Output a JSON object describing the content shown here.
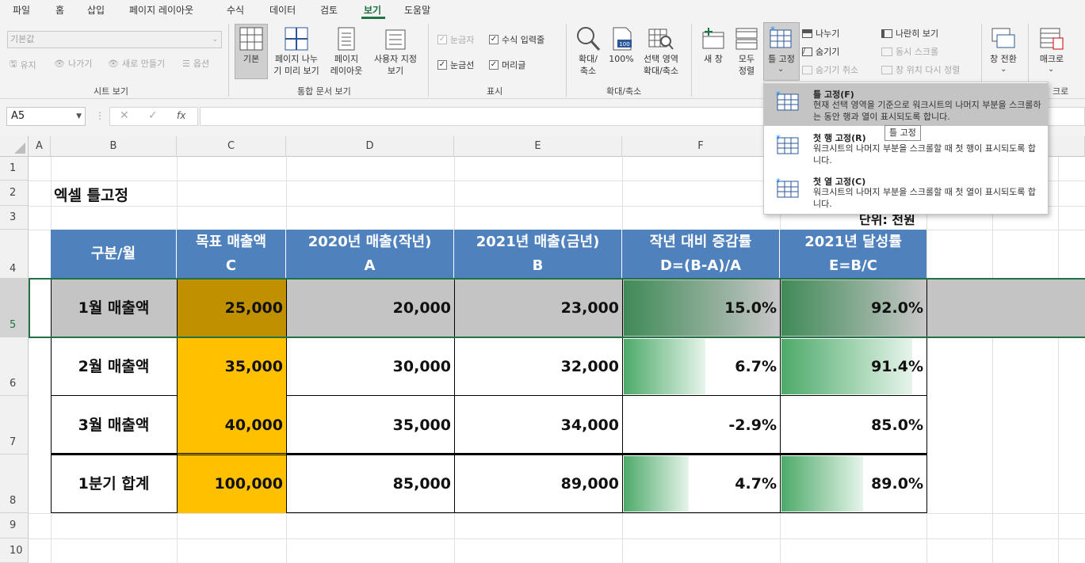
{
  "menu": [
    "파일",
    "홈",
    "삽입",
    "페이지 레이아웃",
    "수식",
    "데이터",
    "검토",
    "보기",
    "도움말"
  ],
  "ribbon": {
    "sheet_view": {
      "dropdown_value": "기본값",
      "keep": "유지",
      "exit": "나가기",
      "new": "새로 만들기",
      "options": "옵션",
      "label": "시트 보기"
    },
    "workbook_views": {
      "normal": "기본",
      "page_break_1": "페이지 나누",
      "page_break_2": "기 미리 보기",
      "page_layout_1": "페이지",
      "page_layout_2": "레이아웃",
      "custom_1": "사용자 지정",
      "custom_2": "보기",
      "label": "통합 문서 보기"
    },
    "show": {
      "ruler": "눈금자",
      "formula_bar": "수식 입력줄",
      "gridlines": "눈금선",
      "headings": "머리글",
      "label": "표시"
    },
    "zoom": {
      "zoom_1": "확대/",
      "zoom_2": "축소",
      "hundred": "100%",
      "selection_1": "선택 영역",
      "selection_2": "확대/축소",
      "label": "확대/축소"
    },
    "window": {
      "new_window": "새 창",
      "arrange_1": "모두",
      "arrange_2": "정렬",
      "freeze": "틀 고정",
      "split": "나누기",
      "hide": "숨기기",
      "unhide": "숨기기 취소",
      "side_by_side": "나란히 보기",
      "sync_scroll": "동시 스크롤",
      "reset_position": "창 위치 다시 정렬",
      "switch_1": "창 전환"
    },
    "macros": {
      "macro": "매크로",
      "label": "크로"
    }
  },
  "formula_bar": {
    "name_box": "A5",
    "fx": "fx",
    "value": ""
  },
  "columns": [
    "A",
    "B",
    "C",
    "D",
    "E",
    "F"
  ],
  "rows": [
    "1",
    "2",
    "3",
    "4",
    "5",
    "6",
    "7",
    "8",
    "9",
    "10"
  ],
  "sheet": {
    "title": "엑셀 틀고정",
    "unit": "단위: 천원",
    "headers": [
      {
        "l1": "구분/월",
        "l2": ""
      },
      {
        "l1": "목표 매출액",
        "l2": "C"
      },
      {
        "l1": "2020년 매출(작년)",
        "l2": "A"
      },
      {
        "l1": "2021년 매출(금년)",
        "l2": "B"
      },
      {
        "l1": "작년 대비 증감률",
        "l2": "D=(B-A)/A"
      },
      {
        "l1": "2021년 달성률",
        "l2": "E=B/C"
      }
    ],
    "data_rows": [
      {
        "label": "1월 매출액",
        "target": "25,000",
        "prev": "20,000",
        "curr": "23,000",
        "growth": "15.0%",
        "achieve": "92.0%",
        "growth_frac": 1.0,
        "achieve_frac": 1.0
      },
      {
        "label": "2월 매출액",
        "target": "35,000",
        "prev": "30,000",
        "curr": "32,000",
        "growth": "6.7%",
        "achieve": "91.4%",
        "growth_frac": 0.53,
        "achieve_frac": 0.91
      },
      {
        "label": "3월 매출액",
        "target": "40,000",
        "prev": "35,000",
        "curr": "34,000",
        "growth": "-2.9%",
        "achieve": "85.0%",
        "growth_frac": 0,
        "achieve_frac": 0
      },
      {
        "label": "1분기 합계",
        "target": "100,000",
        "prev": "85,000",
        "curr": "89,000",
        "growth": "4.7%",
        "achieve": "89.0%",
        "growth_frac": 0.42,
        "achieve_frac": 0.57
      }
    ]
  },
  "dropdown": {
    "items": [
      {
        "title": "틀 고정(F)",
        "desc": "현재 선택 영역을 기준으로 워크시트의 나머지 부분을 스크롤하는 동안 행과 열이 표시되도록 합니다."
      },
      {
        "title": "첫 행 고정(R)",
        "desc": "워크시트의 나머지 부분을 스크롤할 때 첫 행이 표시되도록 합니다."
      },
      {
        "title": "첫 열 고정(C)",
        "desc": "워크시트의 나머지 부분을 스크롤할 때 첫 열이 표시되도록 합니다."
      }
    ],
    "tooltip": "틀 고정"
  },
  "colors": {
    "accent": "#217346",
    "header_blue": "#4f81bd",
    "target_fill": "#ffc000",
    "target_fill_selected": "#c09000"
  }
}
